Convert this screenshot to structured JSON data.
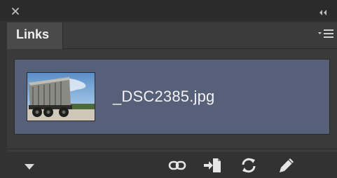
{
  "panel": {
    "tab_label": "Links",
    "links": [
      {
        "name": "_DSC2385.jpg",
        "thumbnail": "dump-truck-thumbnail"
      }
    ]
  },
  "icons": {
    "close": "close-icon",
    "collapse": "double-chevron-icon",
    "menu": "panel-menu-icon",
    "disclosure": "triangle-down-icon",
    "relink": "chain-link-icon",
    "goto_link": "go-to-link-icon",
    "update": "refresh-icon",
    "edit": "pencil-icon"
  },
  "colors": {
    "selection": "#566078",
    "panel_bg": "#323232",
    "text": "#f2f2f2"
  }
}
